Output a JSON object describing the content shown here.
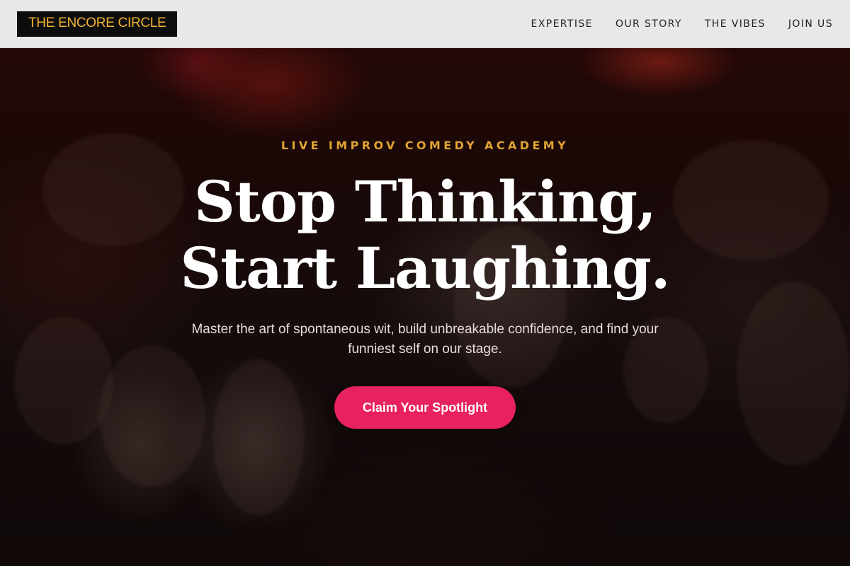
{
  "header": {
    "logo_text": "THE ENCORE CIRCLE",
    "nav": [
      {
        "label": "EXPERTISE"
      },
      {
        "label": "OUR STORY"
      },
      {
        "label": "THE VIBES"
      },
      {
        "label": "JOIN US"
      }
    ]
  },
  "hero": {
    "eyebrow": "LIVE IMPROV COMEDY ACADEMY",
    "headline_line1": "Stop Thinking,",
    "headline_line2": "Start Laughing.",
    "subtext": "Master the art of spontaneous wit, build unbreakable confidence, and find your funniest self on our stage.",
    "cta_label": "Claim Your Spotlight",
    "background_image": "concert-crowd-photo"
  },
  "colors": {
    "accent_gold": "#e0a432",
    "cta_pink": "#e8215f",
    "header_bg": "#e8e8e8",
    "logo_bg": "#0d0d0d",
    "logo_text": "#f2b233"
  }
}
